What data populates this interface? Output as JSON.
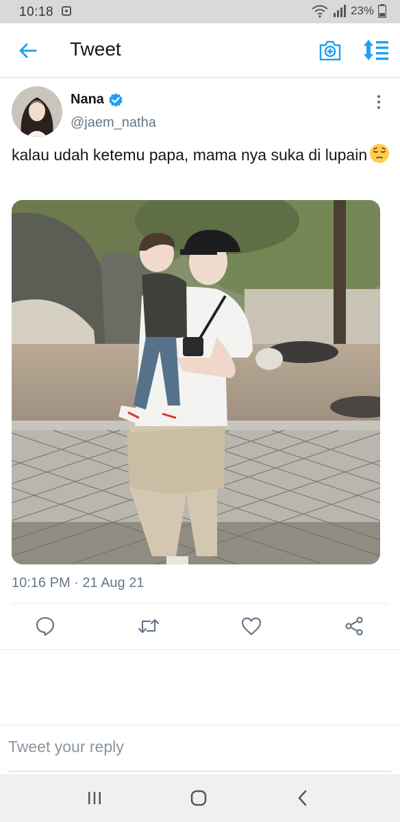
{
  "status": {
    "time": "10:18",
    "battery": "23%"
  },
  "header": {
    "title": "Tweet",
    "back_icon": "back-arrow-icon",
    "camera_icon": "camera-add-icon",
    "sort_icon": "sort-icon",
    "accent": "#1da1f2"
  },
  "tweet": {
    "author_name": "Nana",
    "author_handle": "@jaem_natha",
    "verified": true,
    "text": "kalau udah ketemu papa, mama nya suka di lupain",
    "emoji": "pensive-face",
    "timestamp": "10:16 PM · 21 Aug 21",
    "media_description_icon": "photo"
  },
  "actions": [
    "reply-icon",
    "retweet-icon",
    "like-icon",
    "share-icon"
  ],
  "reply": {
    "placeholder": "Tweet your reply"
  },
  "nav": [
    "recent-apps-icon",
    "home-icon",
    "back-icon"
  ]
}
